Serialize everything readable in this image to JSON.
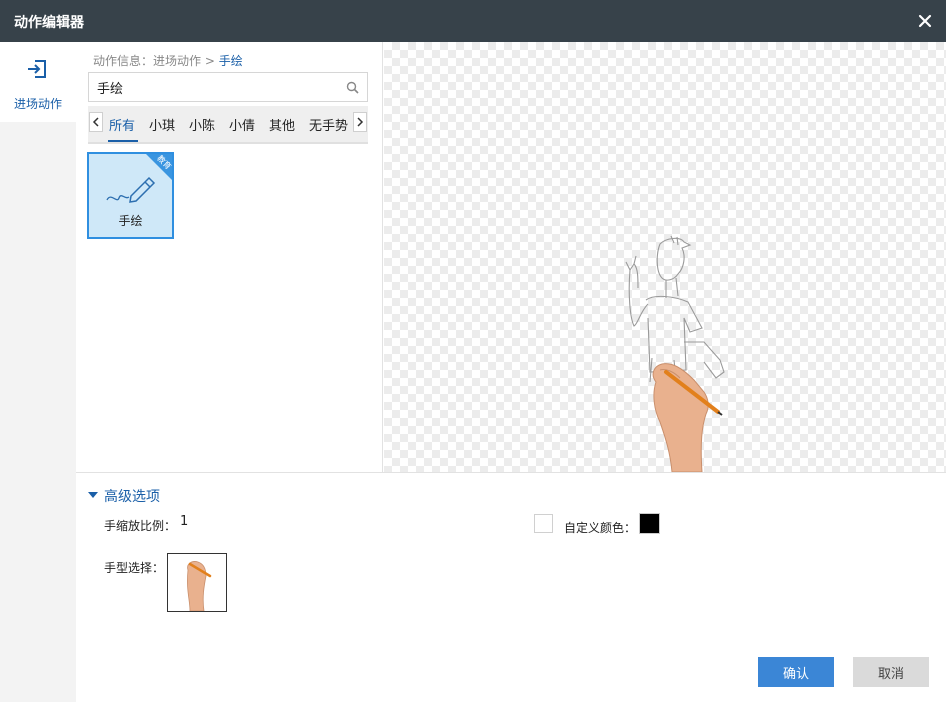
{
  "window": {
    "title": "动作编辑器"
  },
  "sidebar": {
    "items": [
      {
        "label": "进场动作",
        "icon": "enter-icon"
      }
    ]
  },
  "breadcrumb": {
    "prefix": "动作信息：进场动作 >",
    "current": "手绘"
  },
  "search": {
    "value": "手绘",
    "icon": "search-icon"
  },
  "tabs": [
    "所有",
    "小琪",
    "小陈",
    "小倩",
    "其他",
    "无手势"
  ],
  "active_tab": "所有",
  "cards": [
    {
      "label": "手绘",
      "badge": "教育",
      "icon": "pen-icon"
    }
  ],
  "advanced": {
    "toggle_label": "高级选项",
    "scale_label": "手缩放比例：",
    "scale_value": "1",
    "custom_color_label": "自定义颜色：",
    "custom_color_checked": false,
    "custom_color": "#000000",
    "hand_label": "手型选择："
  },
  "buttons": {
    "ok": "确认",
    "cancel": "取消"
  },
  "colors": {
    "titlebar": "#37424a",
    "accent": "#1a5fa8",
    "ok_button": "#3b86d6"
  }
}
